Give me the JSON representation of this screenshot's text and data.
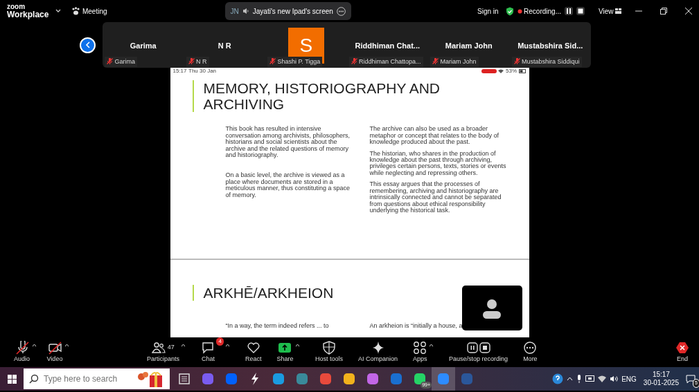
{
  "top_bar": {
    "logo_top": "zoom",
    "logo_bottom": "Workplace",
    "meeting": "Meeting",
    "share_pill": {
      "initials": "JN",
      "label": "Jayati's new Ipad's screen"
    },
    "sign_in": "Sign in",
    "recording": "Recording...",
    "view": "View"
  },
  "participants": [
    {
      "kind": "name",
      "display": "Garima",
      "label": "Garima",
      "muted": true
    },
    {
      "kind": "name",
      "display": "N R",
      "label": "N R",
      "muted": true
    },
    {
      "kind": "avatar",
      "display": "S",
      "color": "#f26d00",
      "label": "Shashi P. Tigga",
      "muted": true
    },
    {
      "kind": "name",
      "display": "Riddhiman  Chat...",
      "label": "Riddhiman Chattopa...",
      "muted": true
    },
    {
      "kind": "name",
      "display": "Mariam John",
      "label": "Mariam John",
      "muted": true
    },
    {
      "kind": "name",
      "display": "Mustabshira  Sid...",
      "label": "Mustabshira Siddiqui",
      "muted": true
    }
  ],
  "shared_screen": {
    "status_time": "15:17",
    "status_date": "Thu 30 Jan",
    "battery": "53%",
    "slides": [
      {
        "title": "MEMORY, HISTORIOGRAPHY AND ARCHIVING",
        "left": [
          "This book has resulted in intensive conversation among archivists, philosophers, historians and social scientists about the archive and the related questions of memory and historiography.",
          "On a basic level, the archive is viewed as a place where documents are stored in a meticulous manner, thus constituting a space of memory."
        ],
        "right": [
          "The archive can also be used as a broader metaphor or concept that relates to the body of knowledge produced about the past.",
          "The historian, who shares in the production of knowledge about the past through archiving, privileges certain persons, texts, stories or events while neglecting and repressing others.",
          "This essay argues that the processes of remembering, archiving and historiography are intrinsically connected and cannot be separated from questions about ethical responsibility underlying the historical task."
        ]
      },
      {
        "title": "ARKHĒ/ARKHEION",
        "left": [
          "“In a way, the term indeed refers ... to"
        ],
        "right": [
          "An arkheion is “initially a house, a"
        ]
      }
    ]
  },
  "toolbar": [
    {
      "label": "Audio",
      "off": true,
      "caret": true
    },
    {
      "label": "Video",
      "off": true,
      "caret": true
    },
    {
      "label": "Participants",
      "count": "47",
      "caret": true
    },
    {
      "label": "Chat",
      "badge": "4",
      "caret": true
    },
    {
      "label": "React",
      "caret": false
    },
    {
      "label": "Share",
      "caret": true
    },
    {
      "label": "Host tools",
      "caret": false
    },
    {
      "label": "AI Companion",
      "caret": false
    },
    {
      "label": "Apps",
      "caret": true
    },
    {
      "label": "Pause/stop recording",
      "caret": false
    },
    {
      "label": "More",
      "caret": false
    },
    {
      "label": "End",
      "caret": false
    }
  ],
  "taskbar": {
    "search_placeholder": "Type here to search",
    "apps": [
      {
        "selected": false
      },
      {
        "selected": false
      },
      {
        "selected": false
      },
      {
        "selected": false
      },
      {
        "selected": false
      },
      {
        "selected": false
      },
      {
        "selected": false
      },
      {
        "selected": false
      },
      {
        "selected": false
      },
      {
        "selected": false
      },
      {
        "selected": false,
        "badge": "99+"
      },
      {
        "selected": true
      },
      {
        "selected": false
      }
    ],
    "language": "ENG",
    "time": "15:17",
    "date": "30-01-2025",
    "notifications": "5"
  }
}
